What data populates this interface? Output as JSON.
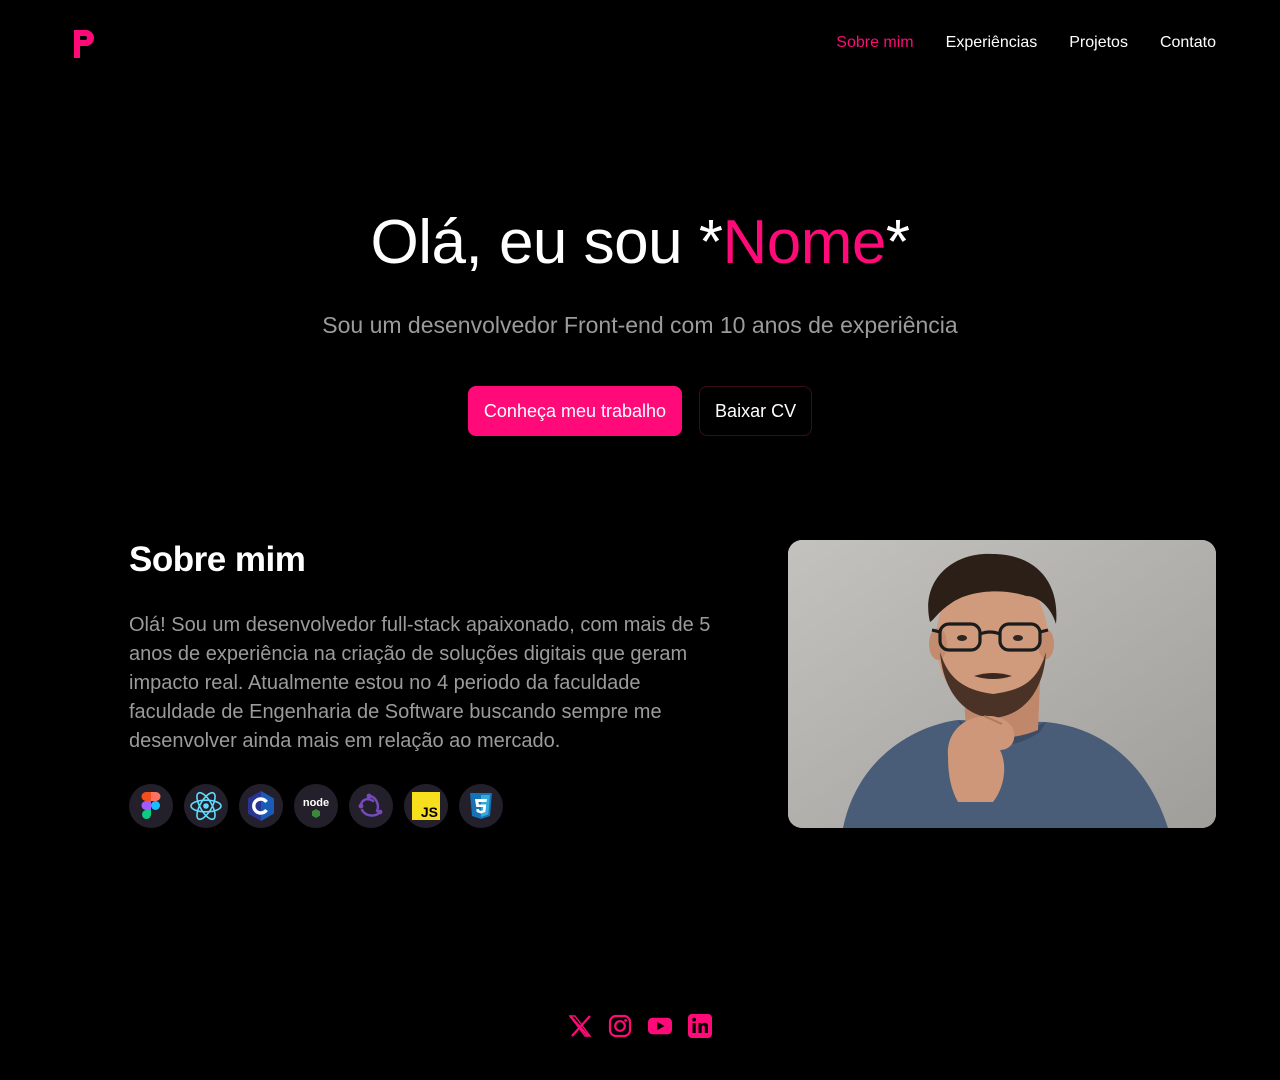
{
  "brand": {
    "logo_letter": "P",
    "accent_color": "#ff0a78"
  },
  "nav": [
    {
      "label": "Sobre mim",
      "active": true
    },
    {
      "label": "Experiências",
      "active": false
    },
    {
      "label": "Projetos",
      "active": false
    },
    {
      "label": "Contato",
      "active": false
    }
  ],
  "hero": {
    "title_prefix": "Olá, eu sou *",
    "title_name": "Nome",
    "title_suffix": "*",
    "subtitle": "Sou um desenvolvedor Front-end com 10 anos de experiência",
    "primary_button": "Conheça meu trabalho",
    "secondary_button": "Baixar CV"
  },
  "about": {
    "title": "Sobre mim",
    "text": "Olá! Sou um desenvolvedor full-stack apaixonado, com mais de 5 anos de experiência na criação de soluções digitais que geram impacto real. Atualmente estou no 4 periodo da faculdade faculdade de Engenharia de Software buscando sempre me desenvolver ainda mais em relação ao mercado.",
    "tech_icons": [
      "figma-icon",
      "react-icon",
      "c-icon",
      "node-icon",
      "redux-icon",
      "javascript-icon",
      "css3-icon"
    ],
    "node_label": "node",
    "js_label": "JS",
    "photo": "portrait-photo"
  },
  "social": [
    "x-icon",
    "instagram-icon",
    "youtube-icon",
    "linkedin-icon"
  ]
}
